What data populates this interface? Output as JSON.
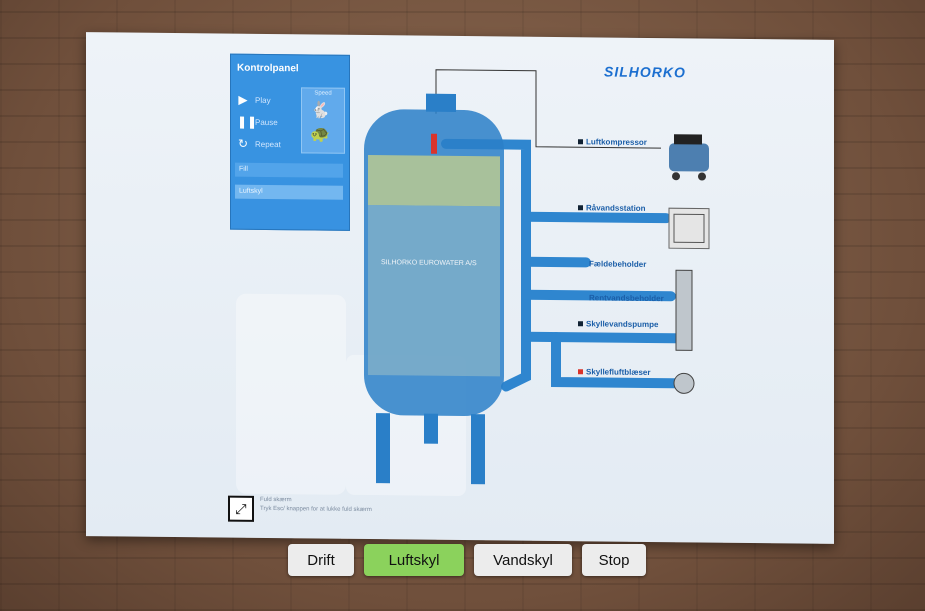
{
  "brand": "SILHORKO",
  "control_panel": {
    "title": "Kontrolpanel",
    "play_label": "Play",
    "pause_label": "Pause",
    "repeat_label": "Repeat",
    "speed_label": "Speed",
    "field1": "Fill",
    "field2": "Luftskyl"
  },
  "tank_label": "SILHORKO EUROWATER A/S",
  "labels": {
    "luftkompressor": "Luftkompressor",
    "raavandsstation": "Råvandsstation",
    "faeldebeholder": "Fældebeholder",
    "rentvandsbeholder": "Rentvandsbeholder",
    "skyllevandspumpe": "Skyllevandspumpe",
    "skyllevandsblaeser": "Skyllefluftblæser"
  },
  "help": {
    "line1": "Fuld skærm",
    "line2": "Tryk Esc/ knappen for at lukke fuld skærm"
  },
  "buttons": {
    "drift": "Drift",
    "luftskyl": "Luftskyl",
    "vandskyl": "Vandskyl",
    "stop": "Stop"
  },
  "active_button": "Luftskyl",
  "colors": {
    "tank_blue": "#2a7fc8",
    "pipe_blue": "#2f86cf",
    "panel_blue": "#2f8ee0",
    "active_green": "#8bd25c",
    "brand_blue": "#1c6fd0"
  },
  "icons": {
    "play": "play-icon",
    "pause": "pause-icon",
    "repeat": "repeat-icon",
    "rabbit": "rabbit-icon",
    "turtle": "turtle-icon",
    "fullscreen": "fullscreen-icon"
  }
}
